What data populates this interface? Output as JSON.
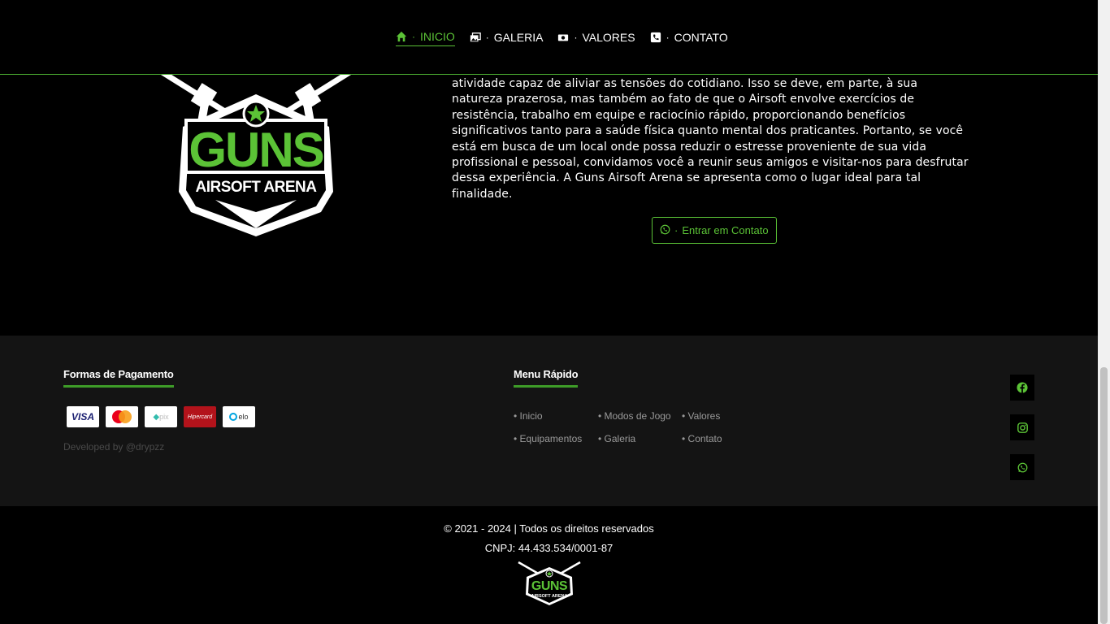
{
  "nav": {
    "items": [
      {
        "label": "INICIO",
        "icon": "home-icon",
        "active": true
      },
      {
        "label": "GALERIA",
        "icon": "gallery-icon",
        "active": false
      },
      {
        "label": "VALORES",
        "icon": "money-icon",
        "active": false
      },
      {
        "label": "CONTATO",
        "icon": "phone-icon",
        "active": false
      }
    ],
    "separator": "·"
  },
  "hero": {
    "logo": {
      "title": "GUNS",
      "subtitle": "AIRSOFT ARENA"
    },
    "text": "atividade capaz de aliviar as tensões do cotidiano. Isso se deve, em parte, à sua natureza prazerosa, mas também ao fato de que o Airsoft envolve exercícios de resistência, trabalho em equipe e raciocínio rápido, proporcionando benefícios significativos tanto para a saúde física quanto mental dos praticantes. Portanto, se você está em busca de um local onde possa reduzir o estresse proveniente de sua vida profissional e pessoal, convidamos você a reunir seus amigos e visitar-nos para desfrutar dessa experiência. A Guns Airsoft Arena se apresenta como o lugar ideal para tal finalidade.",
    "cta_label": "Entrar em Contato",
    "cta_icon": "whatsapp-icon"
  },
  "footer": {
    "payments_title": "Formas de Pagamento",
    "payment_cards": [
      "VISA",
      "mastercard",
      "pix",
      "Hipercard",
      "elo"
    ],
    "developed_by": "Developed by @drypzz",
    "quick_title": "Menu Rápido",
    "quick_links": [
      "• Inicio",
      "• Modos de Jogo",
      "• Valores",
      "• Equipamentos",
      "• Galeria",
      "• Contato"
    ],
    "social": [
      "facebook-icon",
      "instagram-icon",
      "whatsapp-icon"
    ]
  },
  "bottom": {
    "copyright": "© 2021 - 2024 | Todos os direitos reservados",
    "cnpj": "CNPJ: 44.433.534/0001-87",
    "logo": {
      "title": "GUNS",
      "subtitle": "AIRSOFT ARENA"
    }
  },
  "colors": {
    "accent": "#5bc236",
    "background": "#000000",
    "footer_bg": "#141414"
  }
}
